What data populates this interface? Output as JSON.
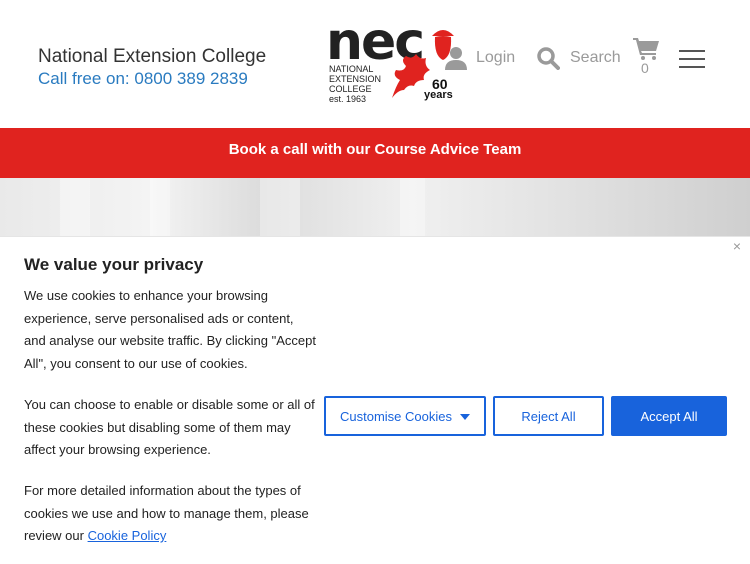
{
  "header": {
    "brand_name": "National Extension College",
    "phone": "Call free on: 0800 389 2839",
    "logo": {
      "wordmark": "nec",
      "sub_lines": [
        "NATIONAL",
        "EXTENSION",
        "COLLEGE",
        "est. 1963"
      ],
      "anniversary_number": "60",
      "anniversary_word": "years"
    },
    "login_label": "Login",
    "search_label": "Search",
    "cart_count": "0"
  },
  "banner": {
    "text": "Book a call with our Course Advice Team"
  },
  "cookie": {
    "title": "We value your privacy",
    "paragraph_1": "We use cookies to enhance your browsing experience, serve personalised ads or content, and analyse our website traffic. By clicking \"Accept All\", you consent to our use of cookies.",
    "paragraph_2": "You can choose to enable or disable some or all of these cookies but disabling some of them may affect your browsing experience.",
    "paragraph_3_prefix": "For more detailed information about the types of cookies we use and how to manage them, please review our ",
    "policy_link": "Cookie Policy",
    "customise_label": "Customise Cookies",
    "reject_label": "Reject All",
    "accept_label": "Accept All",
    "close_glyph": "×"
  },
  "colors": {
    "banner_red": "#e0231f",
    "phone_blue": "#2a7bc0",
    "button_blue": "#1863dc",
    "logo_red": "#e0231f"
  },
  "icons": [
    "user-icon",
    "search-icon",
    "cart-icon",
    "hamburger-menu-icon",
    "close-icon",
    "acorn-icon",
    "oak-leaf-icon",
    "caret-down-icon"
  ]
}
